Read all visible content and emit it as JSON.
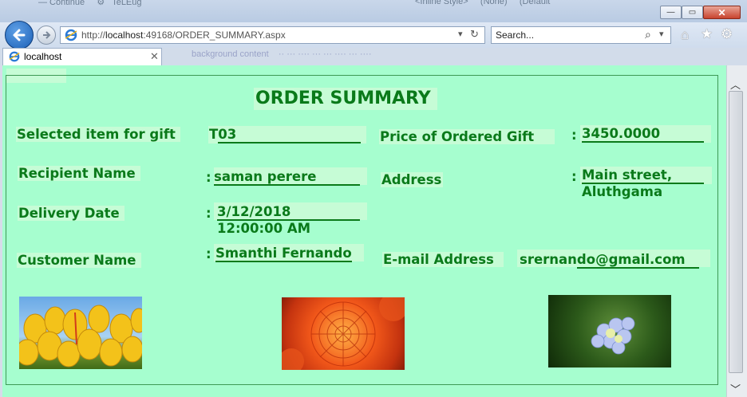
{
  "browser": {
    "url_host": "localhost",
    "url_rest": ":49168/ORDER_SUMMARY.aspx",
    "url_prefix": "http://",
    "search_placeholder": "Search...",
    "tab_title": "localhost"
  },
  "page": {
    "title": "ORDER SUMMARY",
    "fields": {
      "gift_label": "Selected item for gift",
      "gift_prefix": "T",
      "gift_value": "03",
      "price_label": "Price of Ordered Gift",
      "price_colon": ":",
      "price_value": "3450.0000",
      "recipient_label": "Recipient Name",
      "recipient_colon": ":",
      "recipient_value": "saman perere",
      "address_label": "Address",
      "address_colon": ":",
      "address_line1": "Main street,",
      "address_line2": "Aluthgama",
      "delivery_label": "Delivery Date",
      "delivery_colon": ":",
      "delivery_line1": "3/12/2018",
      "delivery_line2": "12:00:00 AM",
      "customer_label": "Customer Name",
      "customer_colon": ":",
      "customer_value": "Smanthi Fernando",
      "email_label": "E-mail Address",
      "email_prefix": "srernan",
      "email_value": "do@gmail.com"
    },
    "images": [
      "yellow-tulips",
      "orange-chrysanthemum",
      "blue-hydrangea"
    ]
  },
  "colors": {
    "page_bg": "#a6fecf",
    "text_green": "#0a7a1a",
    "highlight": "#c6fcd6"
  }
}
